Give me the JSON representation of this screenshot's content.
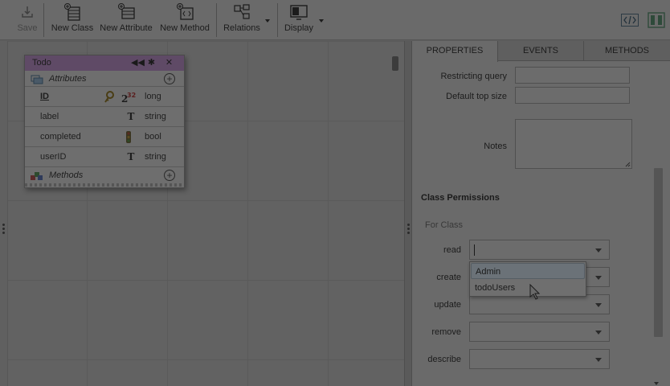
{
  "toolbar": {
    "save": "Save",
    "new_class": "New Class",
    "new_attribute": "New Attribute",
    "new_method": "New Method",
    "relations": "Relations",
    "display": "Display"
  },
  "class_box": {
    "title": "Todo",
    "attributes_label": "Attributes",
    "methods_label": "Methods",
    "attributes": [
      {
        "name": "ID",
        "type": "long",
        "type_icon": "key-number-icon"
      },
      {
        "name": "label",
        "type": "string",
        "type_icon": "text-type-icon"
      },
      {
        "name": "completed",
        "type": "bool",
        "type_icon": "traffic-light-icon"
      },
      {
        "name": "userID",
        "type": "string",
        "type_icon": "text-type-icon"
      }
    ]
  },
  "panel": {
    "tabs": [
      "PROPERTIES",
      "EVENTS",
      "METHODS"
    ],
    "restricting_query_label": "Restricting query",
    "default_top_size_label": "Default top size",
    "notes_label": "Notes",
    "class_permissions_title": "Class Permissions",
    "for_class_label": "For Class",
    "permissions": [
      "read",
      "create",
      "update",
      "remove",
      "describe"
    ]
  },
  "dropdown": {
    "options": [
      "Admin",
      "todoUsers"
    ],
    "highlighted": "Admin"
  }
}
